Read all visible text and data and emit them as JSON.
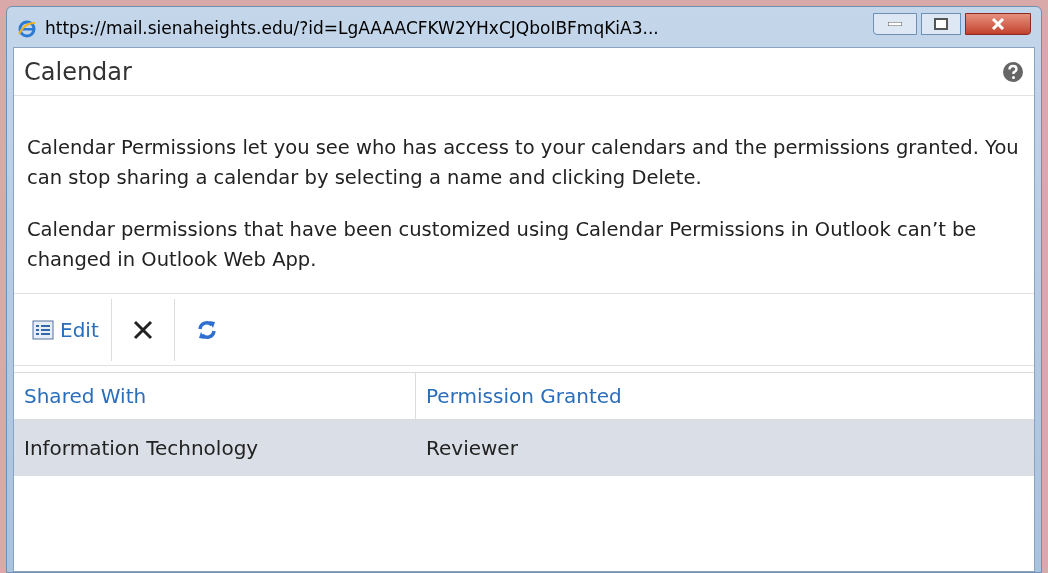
{
  "window": {
    "title": "https://mail.sienaheights.edu/?id=LgAAAACFKW2YHxCJQboIBFmqKiA3..."
  },
  "panel": {
    "title": "Calendar"
  },
  "paragraphs": [
    "Calendar Permissions let you see who has access to your calendars and the permissions granted. You can stop sharing a calendar by selecting a name and clicking Delete.",
    "Calendar permissions that have been customized using Calendar Permissions in Outlook can’t be changed in Outlook Web App."
  ],
  "toolbar": {
    "edit_label": "Edit"
  },
  "table": {
    "columns": [
      "Shared With",
      "Permission Granted"
    ],
    "rows": [
      {
        "cells": [
          "Information Technology",
          "Reviewer"
        ],
        "selected": true
      }
    ]
  }
}
